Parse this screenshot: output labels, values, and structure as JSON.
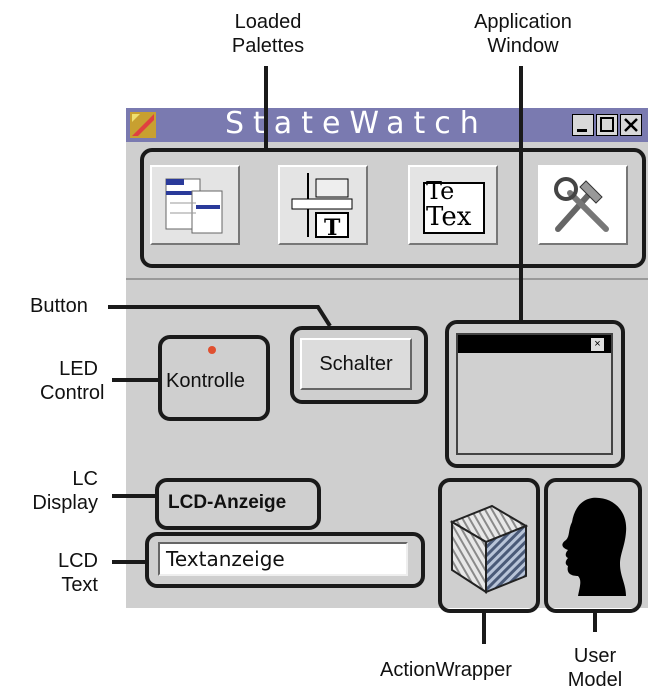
{
  "window": {
    "title": "StateWatch",
    "controls": [
      "minimize-icon",
      "maximize-icon",
      "close-icon"
    ]
  },
  "callouts": {
    "loaded_palettes": [
      "Loaded",
      "Palettes"
    ],
    "application_window": [
      "Application",
      "Window"
    ],
    "button": "Button",
    "led_control": [
      "LED",
      "Control"
    ],
    "lc_display": [
      "LC",
      "Display"
    ],
    "lcd_text": [
      "LCD",
      "Text"
    ],
    "action_wrapper": "ActionWrapper",
    "user_model": [
      "User",
      "Model"
    ]
  },
  "palettes": [
    {
      "icon": "window-layout-icon"
    },
    {
      "icon": "layout-text-icon"
    },
    {
      "icon": "text-field-icon",
      "text": "Tex"
    },
    {
      "icon": "tools-icon"
    }
  ],
  "components": {
    "led_label": "Kontrolle",
    "button_label": "Schalter",
    "lcd_label": "LCD-Anzeige",
    "lcd_text_value": "Textanzeige"
  },
  "colors": {
    "titlebar": "#7a7ab0",
    "window_bg": "#cfcfcf",
    "led": "#e05030"
  }
}
